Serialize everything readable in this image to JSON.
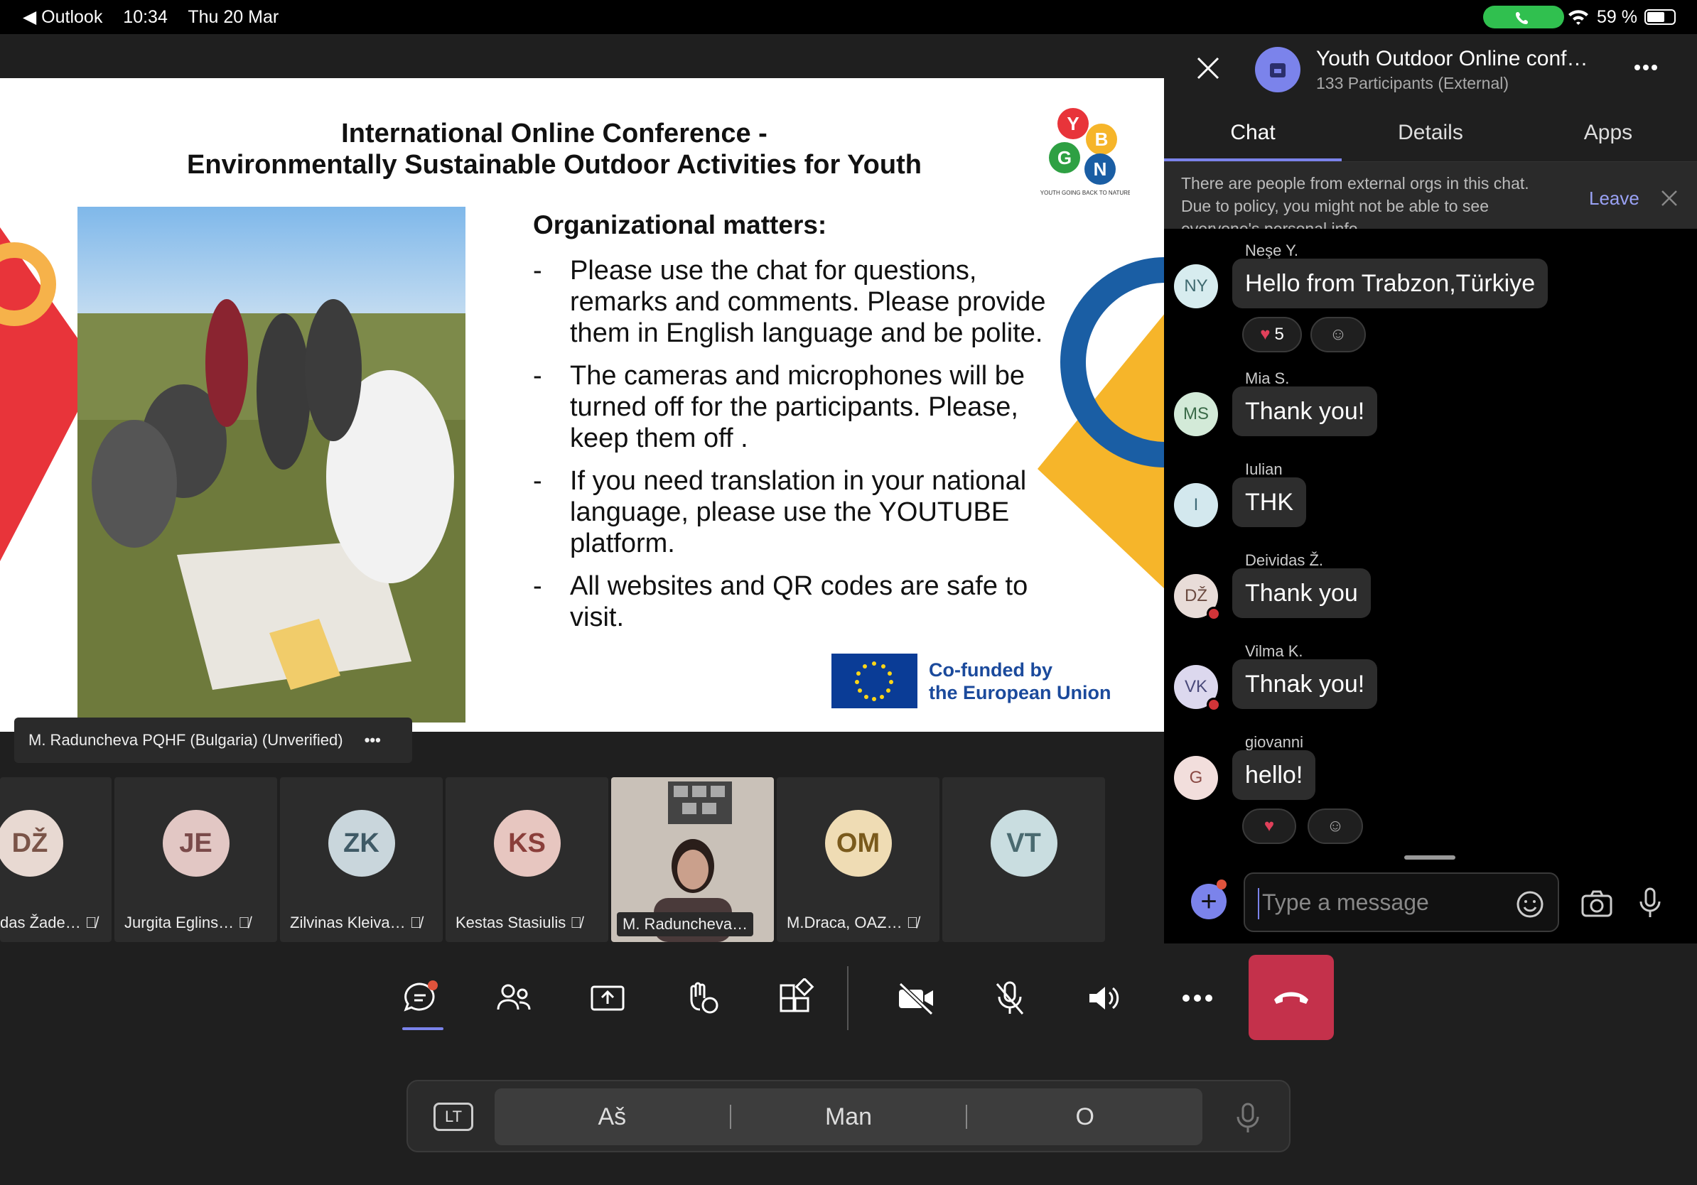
{
  "status_bar": {
    "back_app": "Outlook",
    "time": "10:34",
    "date": "Thu 20 Mar",
    "battery": "59 %"
  },
  "slide": {
    "title_line1": "International Online Conference -",
    "title_line2": "Environmentally  Sustainable Outdoor Activities for Youth",
    "org_heading": "Organizational matters:",
    "bullets": [
      "Please use the chat for questions, remarks and comments. Please provide them in English language and be polite.",
      "The cameras and microphones will be turned off for the participants. Please, keep them off .",
      "If you need translation in your national language, please use the YOUTUBE platform.",
      "All websites and QR codes are safe to visit."
    ],
    "eu_line1": "Co-funded by",
    "eu_line2": "the European Union",
    "logo_letters": [
      "Y",
      "B",
      "G",
      "N"
    ],
    "logo_caption": "YOUTH GOING BACK TO NATURE"
  },
  "presenter_label": "M. Raduncheva PQHF (Bulgaria) (Unverified)",
  "participants": [
    {
      "initials": "DŽ",
      "name": "das Žade…",
      "color": "#e8d9d2"
    },
    {
      "initials": "JE",
      "name": "Jurgita Eglins…",
      "color": "#e2c7c4"
    },
    {
      "initials": "ZK",
      "name": "Zilvinas Kleiva…",
      "color": "#c9d6dc"
    },
    {
      "initials": "KS",
      "name": "Kestas Stasiulis",
      "color": "#e7c6c0"
    },
    {
      "initials": "",
      "name": "M. Raduncheva…",
      "color": "#ddd"
    },
    {
      "initials": "OM",
      "name": "M.Draca, OAZ…",
      "color": "#efdcb4"
    },
    {
      "initials": "VT",
      "name": "",
      "color": "#c9dde0"
    }
  ],
  "captions": {
    "lang": "LT",
    "segments": [
      "Aš",
      "Man",
      "O"
    ]
  },
  "chat": {
    "title": "Youth Outdoor Online conf…",
    "subtitle": "133 Participants (External)",
    "tabs": [
      "Chat",
      "Details",
      "Apps"
    ],
    "notice_line1": "There are people from external orgs in this chat.",
    "notice_line2": "Due to policy, you might not be able to see",
    "notice_line3": "everyone's personal info.",
    "leave_label": "Leave",
    "messages": [
      {
        "sender": "Neşe Y.",
        "initials": "NY",
        "text": "Hello from Trabzon,Türkiye",
        "avatar_color": "#d7ecef",
        "reaction_count": "5"
      },
      {
        "sender": "Mia S.",
        "initials": "MS",
        "text": "Thank you!",
        "avatar_color": "#d3ead8"
      },
      {
        "sender": "Iulian",
        "initials": "I",
        "text": "THK",
        "avatar_color": "#d3e8ee"
      },
      {
        "sender": "Deividas Ž.",
        "initials": "DŽ",
        "text": "Thank you",
        "avatar_color": "#e8dcd8"
      },
      {
        "sender": "Vilma K.",
        "initials": "VK",
        "text": "Thnak you!",
        "avatar_color": "#dcd8ee"
      },
      {
        "sender": "giovanni",
        "initials": "G",
        "text": "hello!",
        "avatar_color": "#f2dedc"
      }
    ],
    "compose_placeholder": "Type a message"
  },
  "colors": {
    "accent": "#7b83eb",
    "end_call": "#c4314b",
    "call_pill": "#30c04f",
    "eu_blue": "#1b4a9c"
  }
}
